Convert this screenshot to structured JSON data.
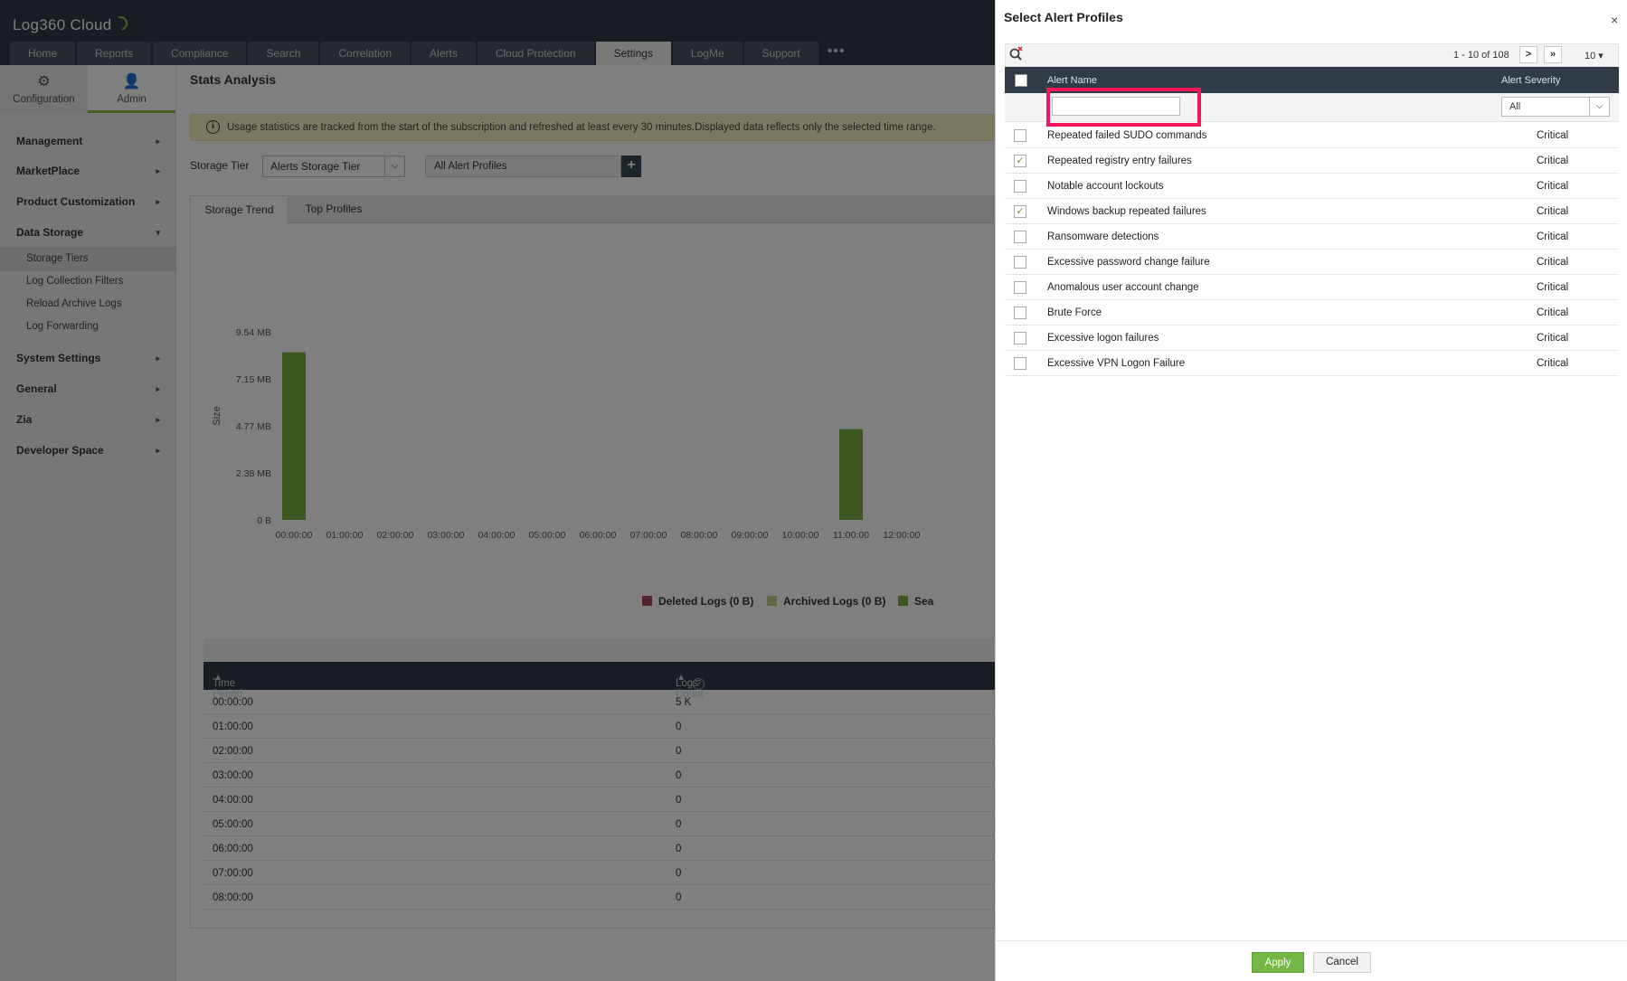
{
  "app": {
    "logo": "Log360 Cloud"
  },
  "nav": {
    "tabs": [
      "Home",
      "Reports",
      "Compliance",
      "Search",
      "Correlation",
      "Alerts",
      "Cloud Protection",
      "Settings",
      "LogMe",
      "Support"
    ],
    "active": "Settings",
    "more": "•••"
  },
  "subtabs": [
    {
      "label": "Configuration",
      "icon": "gear-icon"
    },
    {
      "label": "Admin",
      "icon": "user-icon"
    }
  ],
  "sidebar": {
    "items": [
      {
        "label": "Management"
      },
      {
        "label": "MarketPlace"
      },
      {
        "label": "Product Customization"
      },
      {
        "label": "Data Storage",
        "expanded": true,
        "children": [
          "Storage Tiers",
          "Log Collection Filters",
          "Reload Archive Logs",
          "Log Forwarding"
        ]
      },
      {
        "label": "System Settings"
      },
      {
        "label": "General"
      },
      {
        "label": "Zia"
      },
      {
        "label": "Developer Space"
      }
    ],
    "active_child": "Storage Tiers"
  },
  "page": {
    "title": "Stats Analysis",
    "info": "Usage statistics are tracked from the start of the subscription and refreshed at least every 30 minutes.Displayed data reflects only the selected time range.",
    "storage_tier_label": "Storage Tier",
    "storage_tier_value": "Alerts Storage Tier",
    "profile_value": "All Alert Profiles",
    "chart_tabs": [
      "Storage Trend",
      "Top Profiles"
    ]
  },
  "chart_data": {
    "type": "bar",
    "ylabel": "Size",
    "yticks": [
      "0 B",
      "2.38 MB",
      "4.77 MB",
      "7.15 MB",
      "9.54 MB"
    ],
    "categories": [
      "00:00:00",
      "01:00:00",
      "02:00:00",
      "03:00:00",
      "04:00:00",
      "05:00:00",
      "06:00:00",
      "07:00:00",
      "08:00:00",
      "09:00:00",
      "10:00:00",
      "11:00:00",
      "12:00:00"
    ],
    "series": [
      {
        "name": "Deleted Logs (0 B)",
        "color": "#a54b5c",
        "values": [
          0,
          0,
          0,
          0,
          0,
          0,
          0,
          0,
          0,
          0,
          0,
          0,
          0
        ]
      },
      {
        "name": "Archived Logs (0 B)",
        "color": "#c8cf8f",
        "values": [
          0,
          0,
          0,
          0,
          0,
          0,
          0,
          0,
          0,
          0,
          0,
          0,
          0
        ]
      },
      {
        "name": "Sea",
        "color": "#77ad3c",
        "values": [
          8.5,
          0,
          0,
          0,
          0,
          0,
          0,
          0,
          0,
          0,
          0,
          4.6,
          0
        ]
      }
    ],
    "unit": "MB",
    "ylim": [
      0,
      9.54
    ],
    "legend": "bottom"
  },
  "table": {
    "headers": [
      "Time Period",
      "Logs Count"
    ],
    "rows": [
      [
        "00:00:00",
        "5 K"
      ],
      [
        "01:00:00",
        "0"
      ],
      [
        "02:00:00",
        "0"
      ],
      [
        "03:00:00",
        "0"
      ],
      [
        "04:00:00",
        "0"
      ],
      [
        "05:00:00",
        "0"
      ],
      [
        "06:00:00",
        "0"
      ],
      [
        "07:00:00",
        "0"
      ],
      [
        "08:00:00",
        "0"
      ]
    ]
  },
  "modal": {
    "title": "Select Alert Profiles",
    "close": "×",
    "pagination": "1 - 10 of 108",
    "next": ">",
    "last": "»",
    "per_page": "10 ▾",
    "headers": {
      "name": "Alert Name",
      "severity": "Alert Severity"
    },
    "name_filter": "",
    "severity_filter": "All",
    "rows": [
      {
        "name": "Repeated failed SUDO commands",
        "severity": "Critical",
        "checked": false
      },
      {
        "name": "Repeated registry entry failures",
        "severity": "Critical",
        "checked": true
      },
      {
        "name": "Notable account lockouts",
        "severity": "Critical",
        "checked": false
      },
      {
        "name": "Windows backup repeated failures",
        "severity": "Critical",
        "checked": true
      },
      {
        "name": "Ransomware detections",
        "severity": "Critical",
        "checked": false
      },
      {
        "name": "Excessive password change failure",
        "severity": "Critical",
        "checked": false
      },
      {
        "name": "Anomalous user account change",
        "severity": "Critical",
        "checked": false
      },
      {
        "name": "Brute Force",
        "severity": "Critical",
        "checked": false
      },
      {
        "name": "Excessive logon failures",
        "severity": "Critical",
        "checked": false
      },
      {
        "name": "Excessive VPN Logon Failure",
        "severity": "Critical",
        "checked": false
      }
    ],
    "apply": "Apply",
    "cancel": "Cancel"
  }
}
